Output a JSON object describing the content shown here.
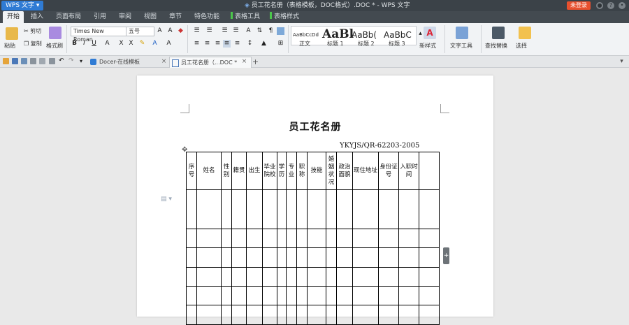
{
  "title_bar": {
    "app_button": "WPS 文字",
    "doc_title": "员工花名册（表格模板，DOC格式）.DOC * - WPS 文字",
    "login_label": "未登录"
  },
  "menu": {
    "tabs": [
      "开始",
      "插入",
      "页面布局",
      "引用",
      "审阅",
      "视图",
      "章节",
      "特色功能",
      "表格工具",
      "表格样式"
    ]
  },
  "ribbon": {
    "paste_label": "粘贴",
    "cut_label": "剪切",
    "copy_label": "复制",
    "format_painter_label": "格式刷",
    "font_name": "Times New Roman",
    "font_size": "五号",
    "styles": [
      {
        "preview": "AaBbCcDd",
        "label": "正文"
      },
      {
        "preview": "AaBl",
        "label": "标题 1"
      },
      {
        "preview": "AaBb(",
        "label": "标题 2"
      },
      {
        "preview": "AaBbC",
        "label": "标题 3"
      }
    ],
    "new_style_label": "新样式",
    "text_tools_label": "文字工具",
    "find_replace_label": "查找替换",
    "select_label": "选择"
  },
  "tabs_bar": {
    "doc_tabs": [
      "Docer-在线模板",
      "员工花名册（...DOC *"
    ]
  },
  "document": {
    "heading": "员工花名册",
    "code": "YKYJS/QR-62203-2005",
    "table_headers": [
      "序号",
      "姓名",
      "性别",
      "籍贯",
      "出生",
      "毕业院校",
      "学历",
      "专业",
      "职称",
      "技能",
      "婚姻状况",
      "政治面貌",
      "现住地址",
      "身份证号",
      "入职时间",
      ""
    ],
    "empty_rows": 6
  },
  "colors": {
    "title_bar": "#3b4248",
    "menu_bar": "#434a50",
    "ribbon": "#f1f3f5",
    "accent_blue": "#2f7bd4",
    "login_red": "#e8502e",
    "table_tool_green": "#4bc74b"
  }
}
